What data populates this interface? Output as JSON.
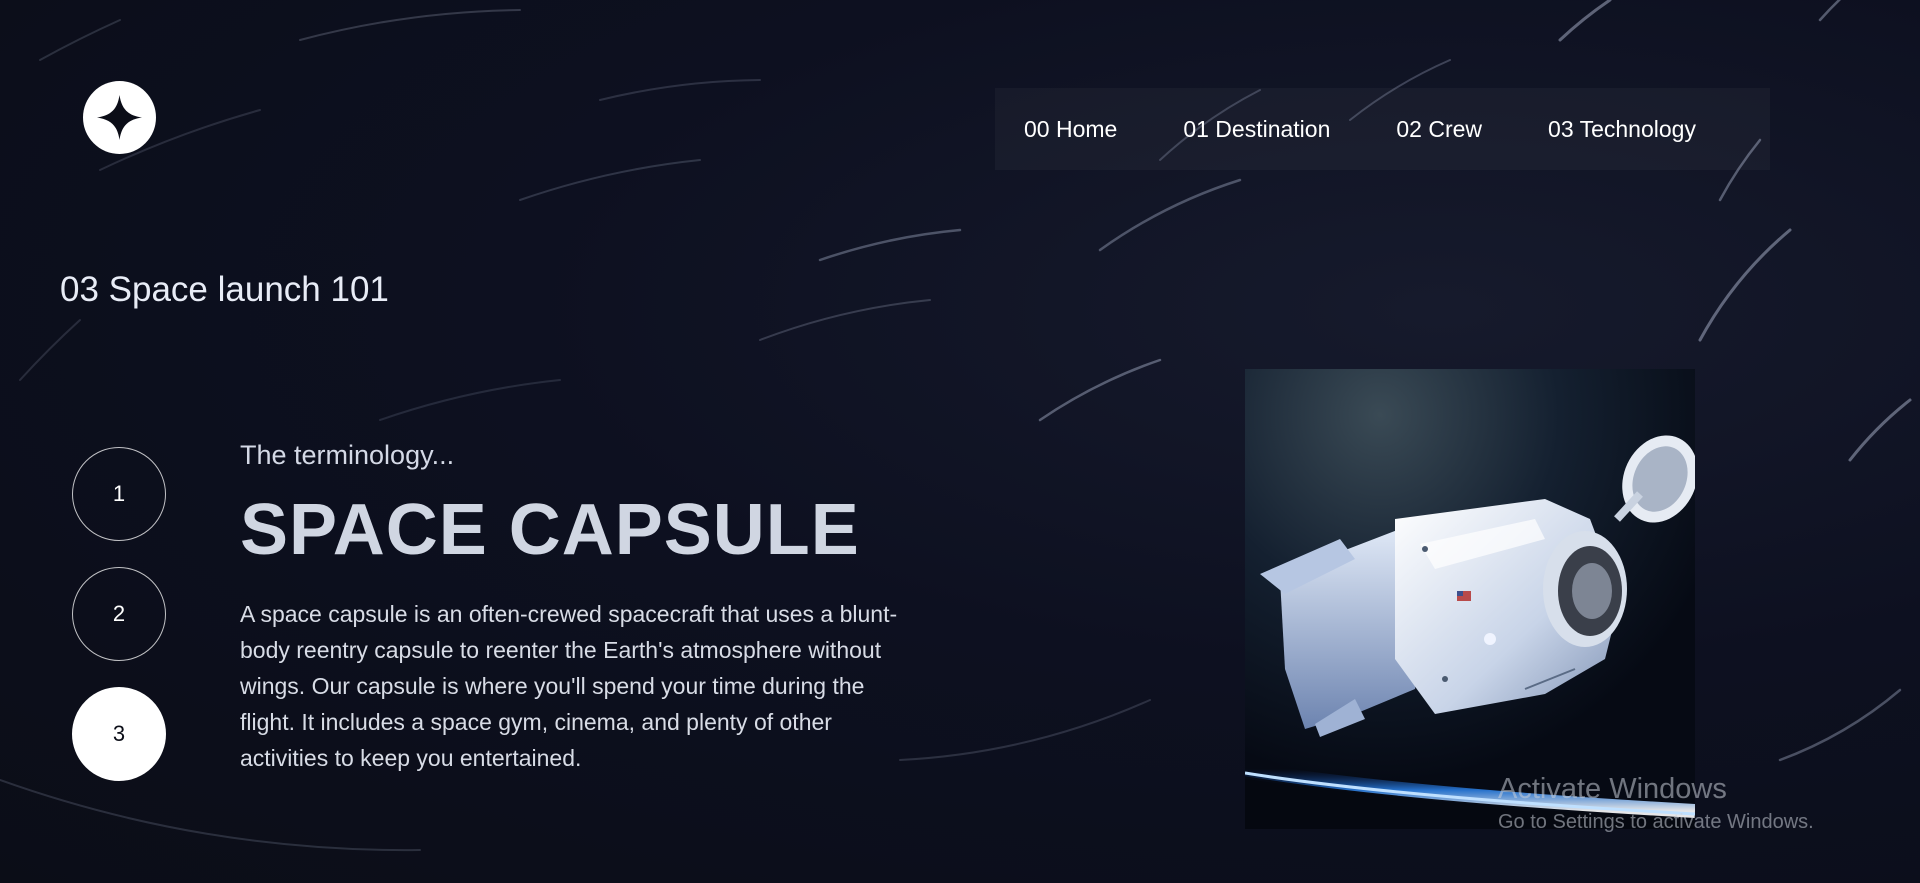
{
  "nav": {
    "items": [
      {
        "label": "00 Home"
      },
      {
        "label": "01 Destination"
      },
      {
        "label": "02 Crew"
      },
      {
        "label": "03 Technology"
      }
    ]
  },
  "page": {
    "heading": "03 Space launch 101"
  },
  "steps": [
    {
      "label": "1",
      "active": false
    },
    {
      "label": "2",
      "active": false
    },
    {
      "label": "3",
      "active": true
    }
  ],
  "technology": {
    "subtitle": "The terminology...",
    "name": "SPACE CAPSULE",
    "description": "A space capsule is an often-crewed spacecraft that uses a blunt-body reentry capsule to reenter the Earth's atmosphere without wings. Our capsule is where you'll spend your time during the flight. It includes a space gym, cinema, and plenty of other activities to keep you entertained."
  },
  "watermark": {
    "title": "Activate Windows",
    "subtitle": "Go to Settings to activate Windows."
  },
  "icons": {
    "logo": "four-point-star-icon"
  },
  "colors": {
    "background": "#0b0d17",
    "text": "#ffffff",
    "accent": "#d0d6e2"
  }
}
